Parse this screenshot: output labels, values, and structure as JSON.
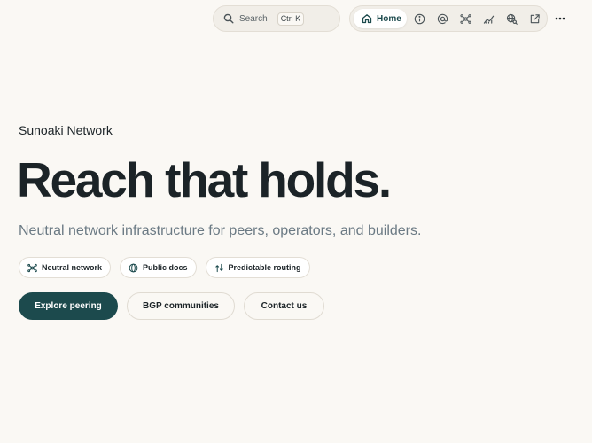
{
  "topbar": {
    "search": {
      "label": "Search",
      "shortcut": "Ctrl K"
    },
    "nav": {
      "home_label": "Home",
      "icons": [
        "info-icon",
        "at-sign-icon",
        "network-icon",
        "chart-icon",
        "globe-search-icon",
        "external-link-icon"
      ]
    },
    "more_icon": "more-icon"
  },
  "hero": {
    "eyebrow": "Sunoaki Network",
    "headline": "Reach that holds.",
    "subhead": "Neutral network infrastructure for peers, operators, and builders.",
    "chips": [
      {
        "label": "Neutral network",
        "icon": "network-icon"
      },
      {
        "label": "Public docs",
        "icon": "globe-icon"
      },
      {
        "label": "Predictable routing",
        "icon": "routing-icon"
      }
    ],
    "actions": {
      "primary": "Explore peering",
      "secondary": "BGP communities",
      "tertiary": "Contact us"
    }
  },
  "colors": {
    "background": "#faf8f4",
    "accent": "#1c4a4d",
    "text": "#1b2327",
    "muted": "#6b7a84"
  }
}
